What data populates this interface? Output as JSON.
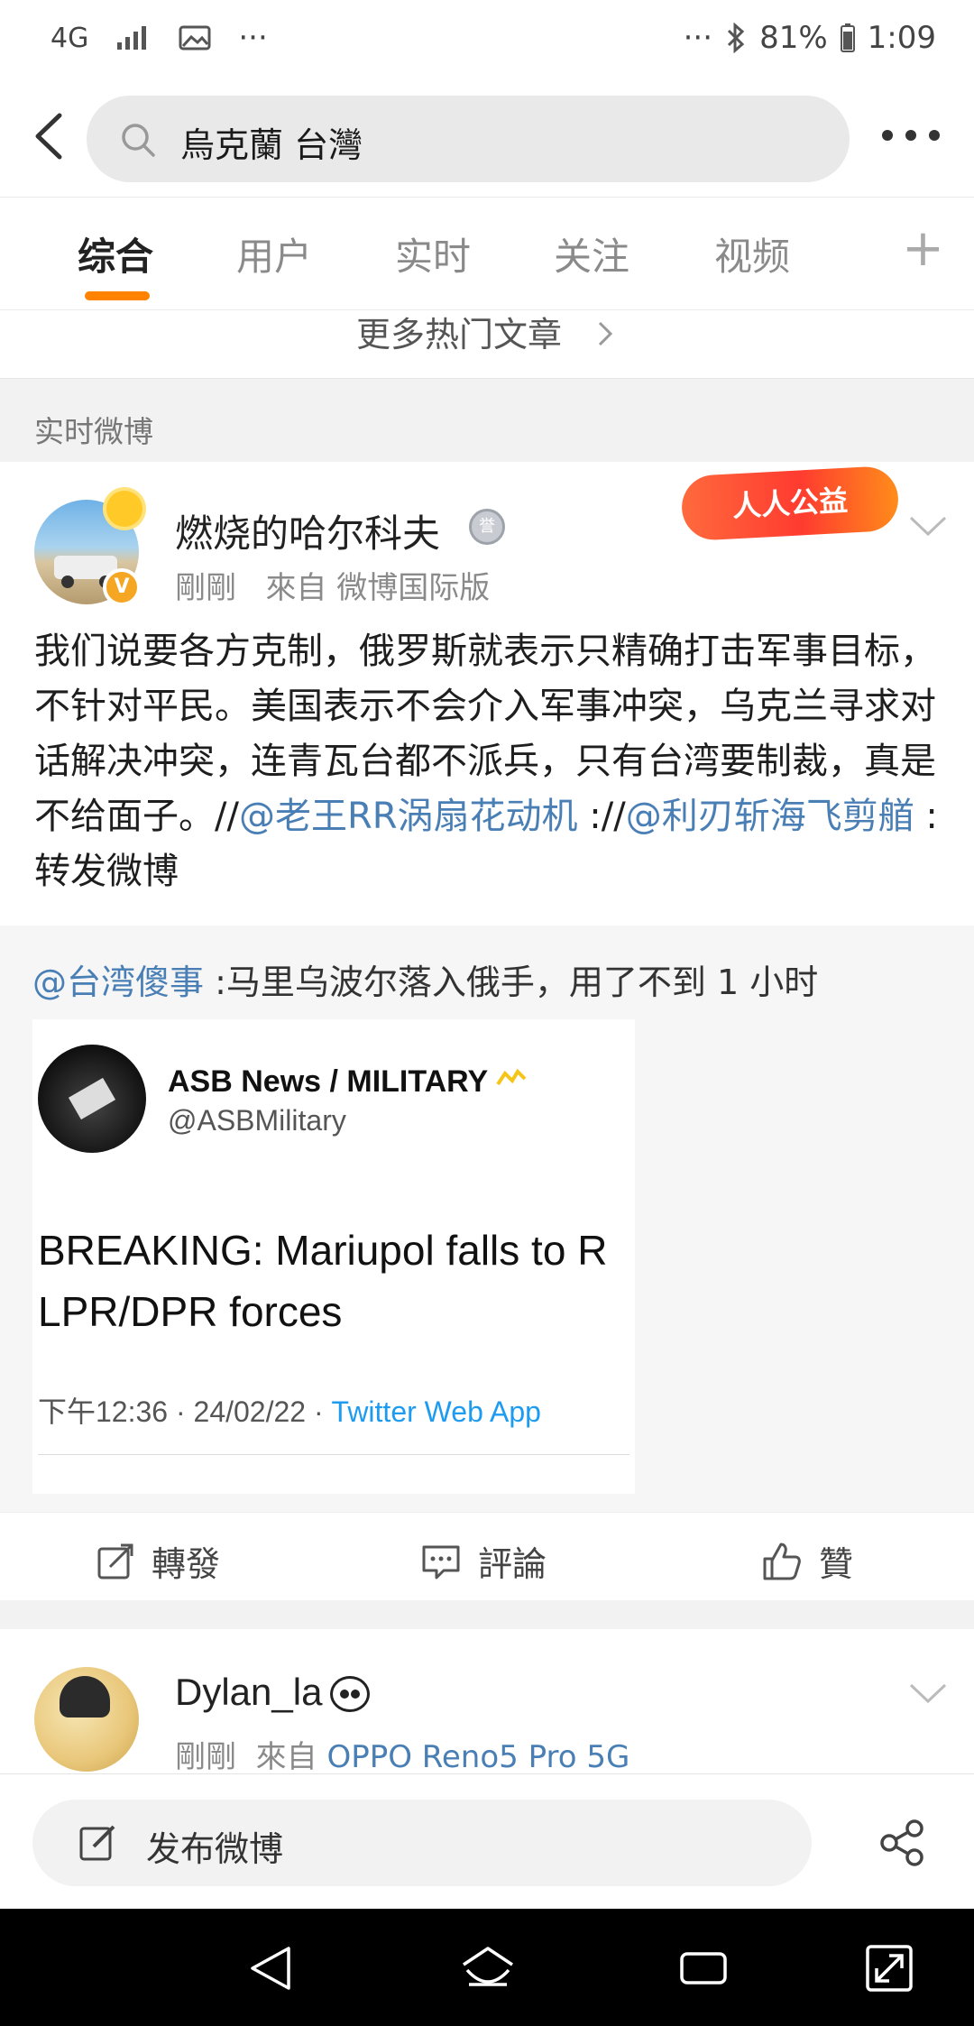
{
  "status_bar": {
    "network": "4G",
    "dots_left": "···",
    "dots_right": "···",
    "battery": "81%",
    "time": "1:09"
  },
  "search": {
    "query": "烏克蘭 台灣"
  },
  "tabs": [
    {
      "label": "综合",
      "active": true
    },
    {
      "label": "用户",
      "active": false
    },
    {
      "label": "实时",
      "active": false
    },
    {
      "label": "关注",
      "active": false
    },
    {
      "label": "视频",
      "active": false
    }
  ],
  "more_articles": "更多热门文章",
  "section_label": "实时微博",
  "post": {
    "username": "燃烧的哈尔科夫",
    "time": "剛剛",
    "source": "來自 微博国际版",
    "badge": "人人公益",
    "text_plain": "我们说要各方克制，俄罗斯就表示只精确打击军事目标，不针对平民。美国表示不会介入军事冲突，乌克兰寻求对话解决冲突，连青瓦台都不派兵，只有台湾要制裁，真是不给面子。//",
    "mention_1": "@老王RR涡扇花动机",
    "sep_1": " ://",
    "mention_2": "@利刃斩海飞剪艏",
    "sep_2": " :转发微博",
    "repost": {
      "mention": "@台湾傻事",
      "text": " :马里乌波尔落入俄手，用了不到 1 小时",
      "embed": {
        "name": "ASB News / MILITARY",
        "handle": "@ASBMilitary",
        "body_line1": "BREAKING: Mariupol falls to R",
        "body_line2": "LPR/DPR forces",
        "timestamp": "下午12:36 · 24/02/22 · ",
        "app": "Twitter Web App"
      }
    },
    "actions": {
      "repost": "轉發",
      "comment": "評論",
      "like": "贊"
    }
  },
  "post2": {
    "username": "Dylan_la",
    "time": "剛剛",
    "source_prefix": "來自 ",
    "device": "OPPO Reno5 Pro 5G"
  },
  "compose": {
    "label": "发布微博"
  },
  "colors": {
    "accent": "#ff8200",
    "link": "#4a7fb5",
    "twitter_blue": "#1d9bf0"
  }
}
